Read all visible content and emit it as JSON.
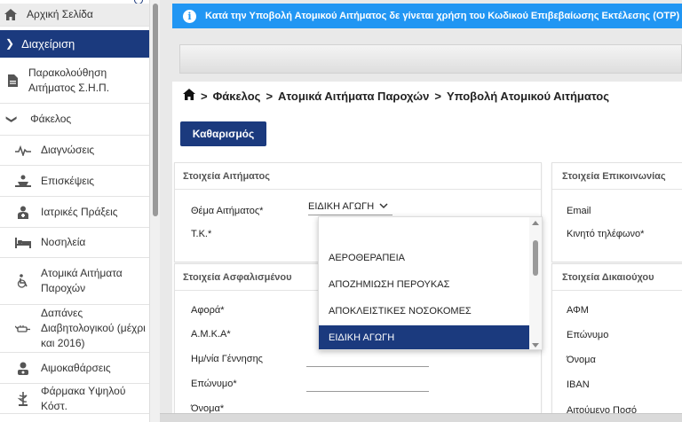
{
  "sidebar": {
    "items": [
      {
        "label": "Αρχική Σελίδα",
        "icon": "home-icon"
      },
      {
        "label": "Διαχείριση",
        "icon": "chevron-down-icon"
      },
      {
        "label": "Παρακολούθηση Αιτήματος Σ.Η.Π.",
        "icon": "document-icon"
      },
      {
        "label": "Φάκελος",
        "icon": "chevron-down-icon"
      },
      {
        "label": "Διαγνώσεις",
        "icon": "heartbeat-icon"
      },
      {
        "label": "Επισκέψεις",
        "icon": "visit-icon"
      },
      {
        "label": "Ιατρικές Πράξεις",
        "icon": "doctor-icon"
      },
      {
        "label": "Νοσηλεία",
        "icon": "bed-icon"
      },
      {
        "label": "Ατομικά Αιτήματα Παροχών",
        "icon": "wheelchair-icon"
      },
      {
        "label": "Δαπάνες Διαβητολογικού (μέχρι και 2016)",
        "icon": "syringe-icon"
      },
      {
        "label": "Αιμοκαθάρσεις",
        "icon": "dialysis-icon"
      },
      {
        "label": "Φάρμακα Υψηλού Κόστ.",
        "icon": "pharmacy-icon"
      }
    ]
  },
  "banner": {
    "text": "Κατά την Υποβολή Ατομικού Αιτήματος δε γίνεται χρήση του Κωδικού Επιβεβαίωσης Εκτέλεσης (OTP)",
    "icon": "info-icon",
    "color": "#2196f3"
  },
  "breadcrumb": {
    "items": [
      "Φάκελος",
      "Ατομικά Αιτήματα Παροχών",
      "Υποβολή Ατομικού Αιτήματος"
    ],
    "separator": ">"
  },
  "clear_button": {
    "label": "Καθαρισμός"
  },
  "request_panel": {
    "title": "Στοιχεία Αιτήματος",
    "subject_label": "Θέμα Αιτήματος*",
    "subject_value": "ΕΙΔΙΚΗ ΑΓΩΓΗ",
    "tk_label": "Τ.Κ.*"
  },
  "insured_panel": {
    "title": "Στοιχεία Ασφαλισμένου",
    "fields": [
      "Αφορά*",
      "Α.Μ.Κ.Α*",
      "Ημ/νία Γέννησης",
      "Επώνυμο*",
      "Όνομα*"
    ]
  },
  "contact_panel": {
    "title": "Στοιχεία Επικοινωνίας",
    "fields": [
      "Email",
      "Κινητό τηλέφωνο*"
    ]
  },
  "beneficiary_panel": {
    "title": "Στοιχεία Δικαιούχου",
    "fields": [
      "ΑΦΜ",
      "Επώνυμο",
      "Όνομα",
      "IBAN",
      "Αιτούμενο Ποσό"
    ]
  },
  "dropdown": {
    "options": [
      "ΑΕΡΟΘΕΡΑΠΕΙΑ",
      "ΑΠΟΖΗΜΙΩΣΗ ΠΕΡΟΥΚΑΣ",
      "ΑΠΟΚΛΕΙΣΤΙΚΕΣ ΝΟΣΟΚΟΜΕΣ",
      "ΕΙΔΙΚΗ ΑΓΩΓΗ"
    ],
    "selected": "ΕΙΔΙΚΗ ΑΓΩΓΗ"
  },
  "colors": {
    "primary": "#1b3a7e",
    "banner": "#2196f3",
    "selected_option": "#1b3a7e"
  }
}
